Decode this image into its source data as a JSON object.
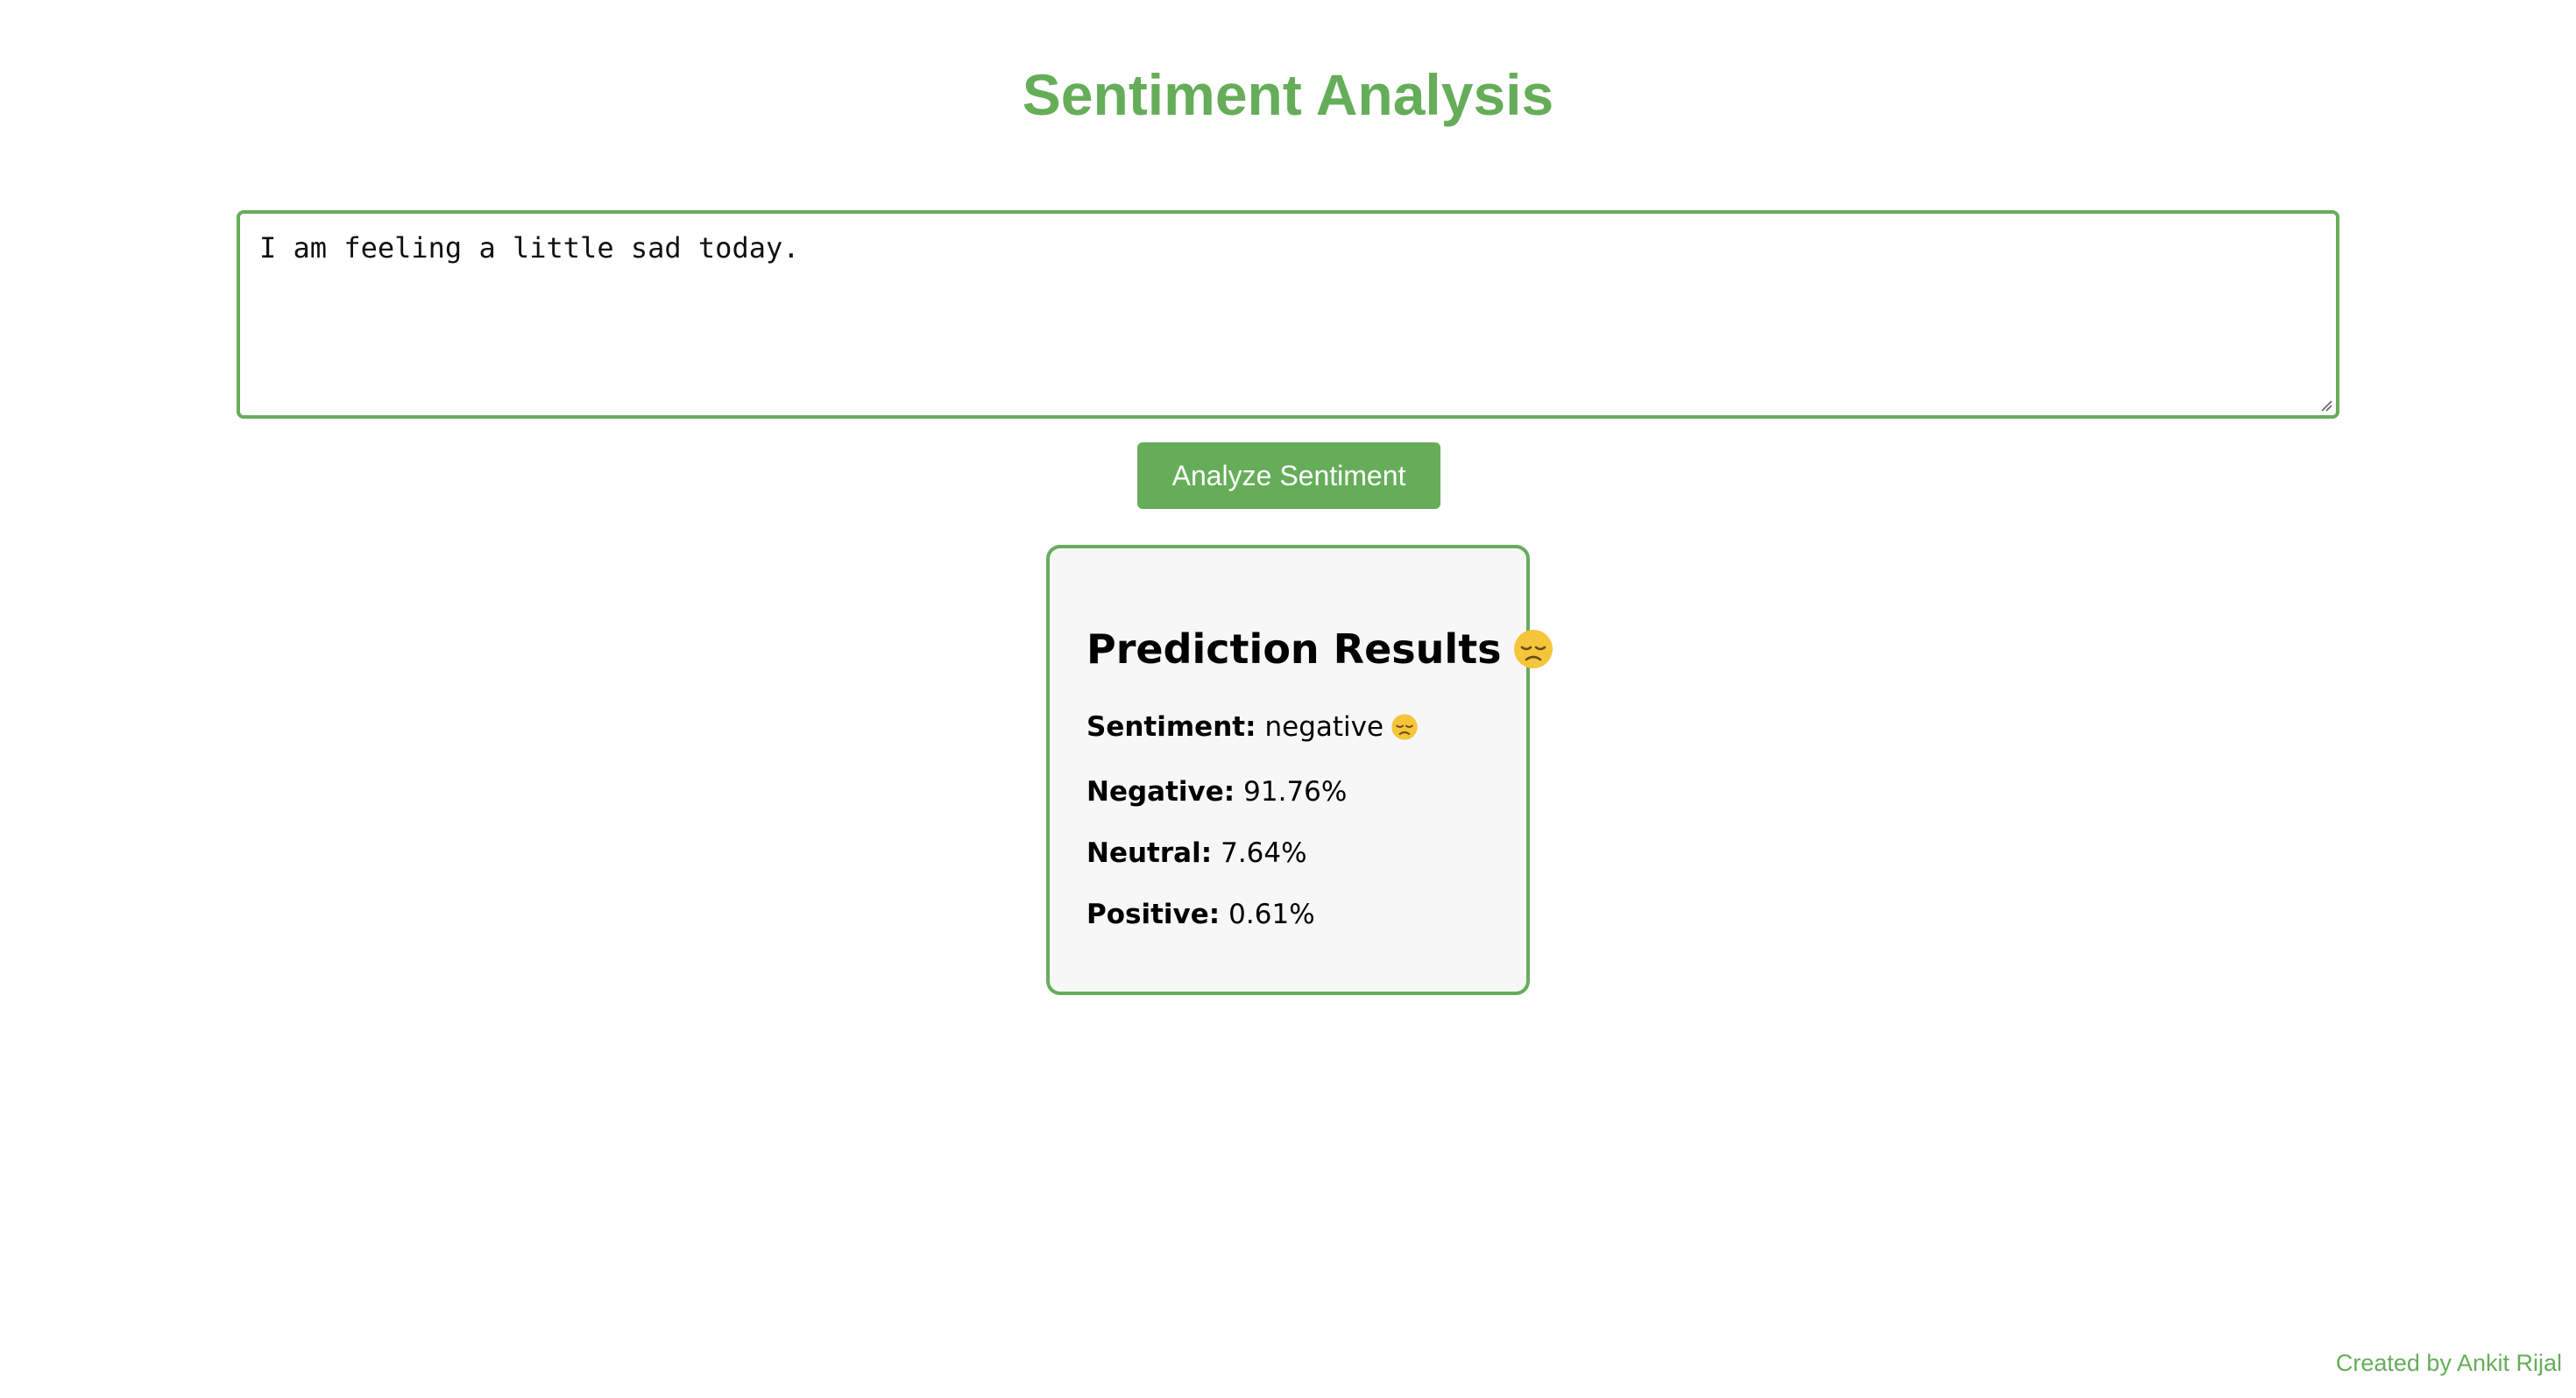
{
  "title": "Sentiment Analysis",
  "input": {
    "value": "I am feeling a little sad today.",
    "placeholder": ""
  },
  "analyze_button": {
    "label": "Analyze Sentiment"
  },
  "results": {
    "heading": "Prediction Results",
    "heading_icon": "disappointed-face-emoji",
    "rows": [
      {
        "label": "Sentiment:",
        "value": "negative",
        "icon": "disappointed-face-emoji"
      },
      {
        "label": "Negative:",
        "value": "91.76%"
      },
      {
        "label": "Neutral:",
        "value": "7.64%"
      },
      {
        "label": "Positive:",
        "value": "0.61%"
      }
    ]
  },
  "footer": {
    "credit": "Created by Ankit Rijal"
  },
  "colors": {
    "accent": "#66ad5a",
    "card_background": "#f7f7f7",
    "emoji_face": "#f5c53a"
  }
}
